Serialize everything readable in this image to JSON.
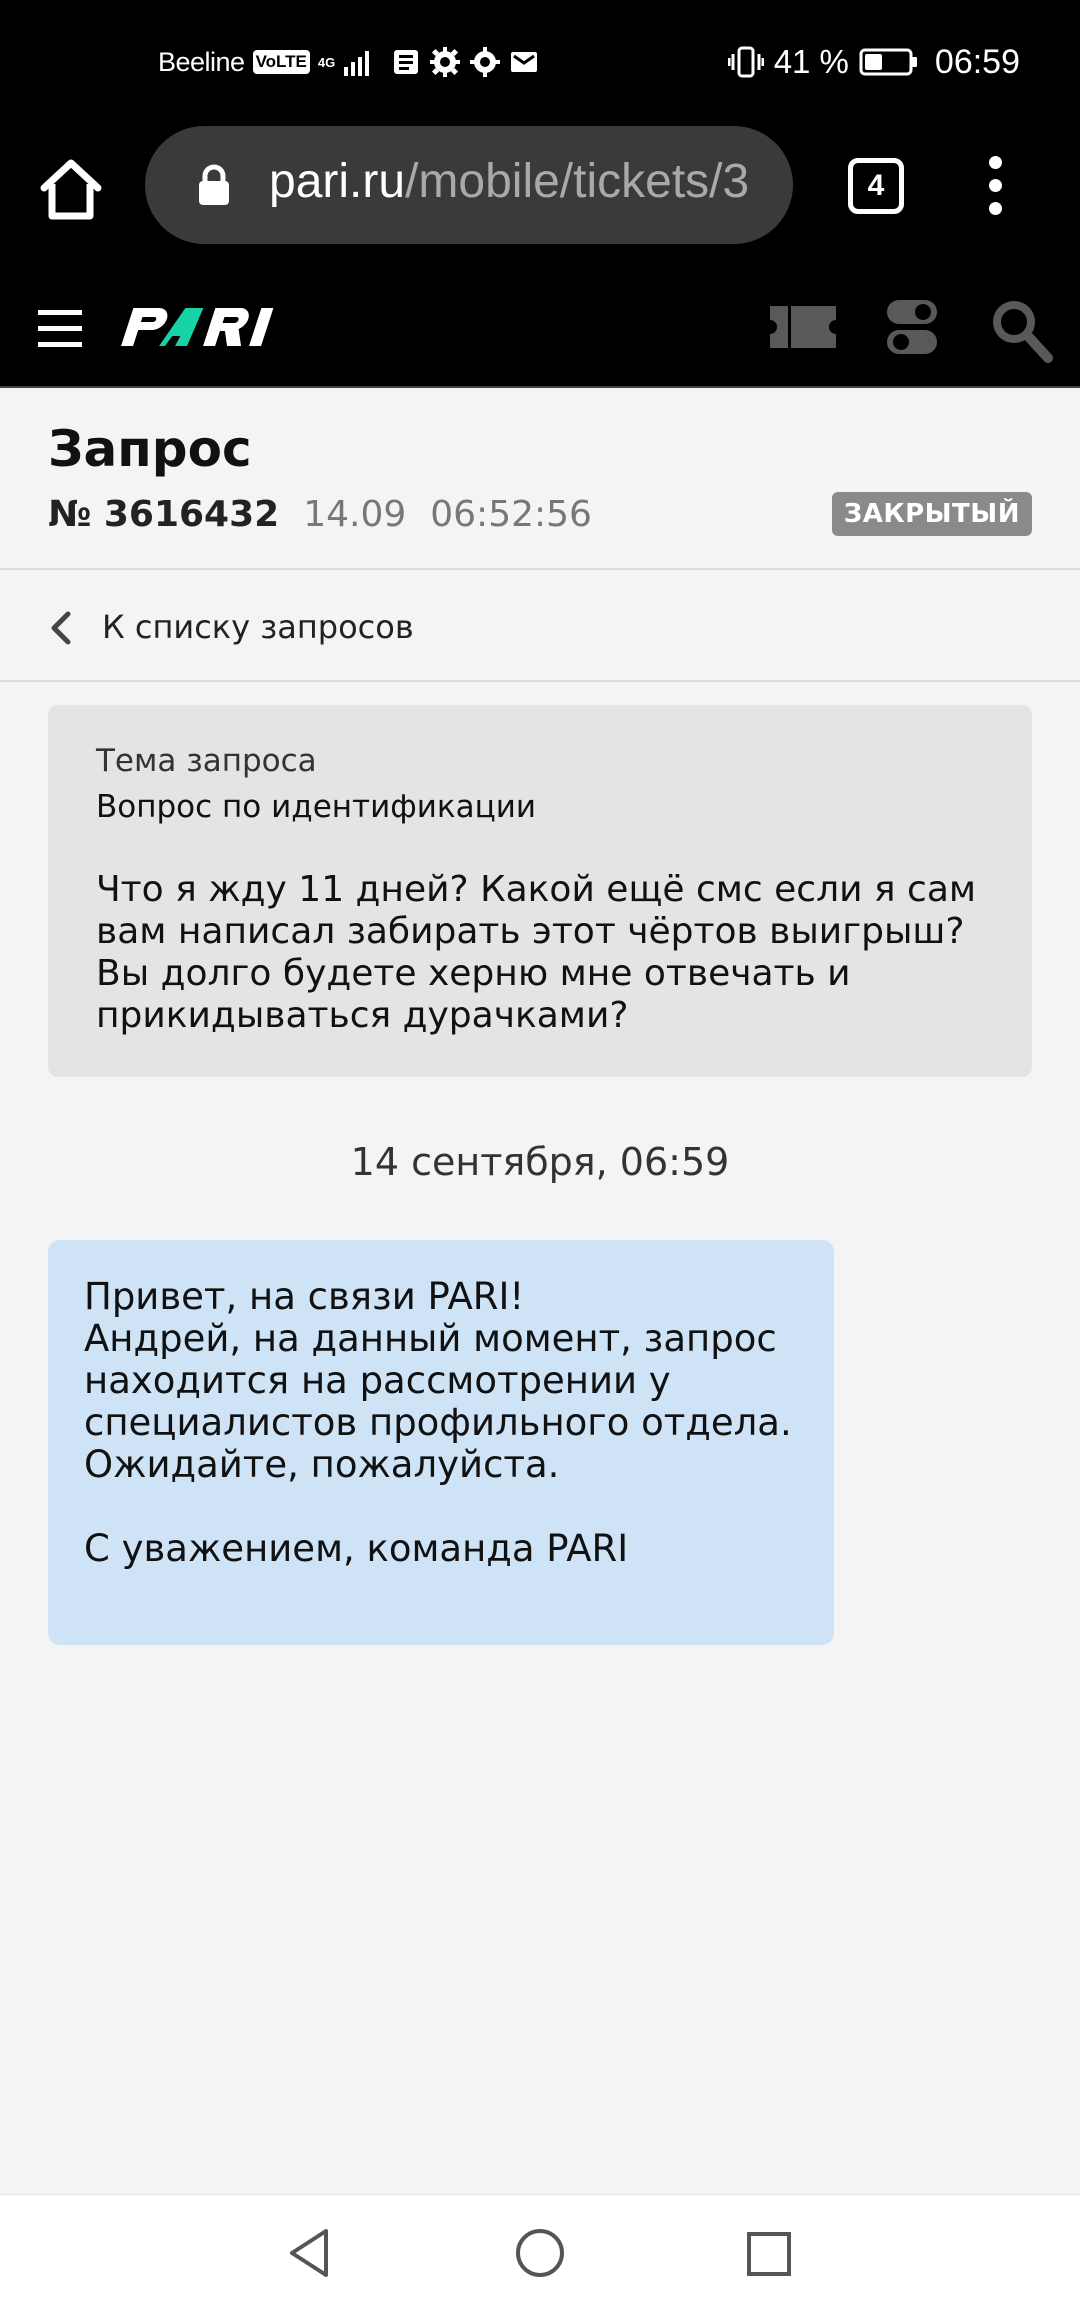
{
  "status_bar": {
    "carrier": "Beeline",
    "volte": "VoLTE",
    "network": "4G",
    "battery_pct": "41 %",
    "battery_level": 0.41,
    "time": "06:59",
    "icons": [
      "signal-icon",
      "news-icon",
      "settings-icon",
      "settings-icon",
      "mail-icon",
      "vibrate-icon",
      "battery-icon"
    ]
  },
  "browser": {
    "url_host": "pari.ru",
    "url_path": "/mobile/tickets/3",
    "tab_count": "4"
  },
  "site_header": {
    "logo": "PARI",
    "brand_color": "#18d2a8"
  },
  "ticket": {
    "title": "Запрос",
    "number": "№ 3616432",
    "date": "14.09",
    "time": "06:52:56",
    "status": "ЗАКРЫТЫЙ"
  },
  "back_link": {
    "label": "К списку запросов"
  },
  "question": {
    "label": "Тема запроса",
    "topic": "Вопрос по идентификации",
    "text": "Что я жду 11 дней? Какой ещё смс если я сам вам написал забирать этот чёртов выигрыш? Вы долго будете херню мне отвечать и прикидываться дурачками?"
  },
  "conversation": {
    "date": "14 сентября, 06:59",
    "reply": "Привет, на связи PARI!\nАндрей, на данный момент, запрос находится на рассмотрении у специалистов профильного отдела.\nОжидайте, пожалуйста.\n\nС уважением, команда PARI"
  }
}
